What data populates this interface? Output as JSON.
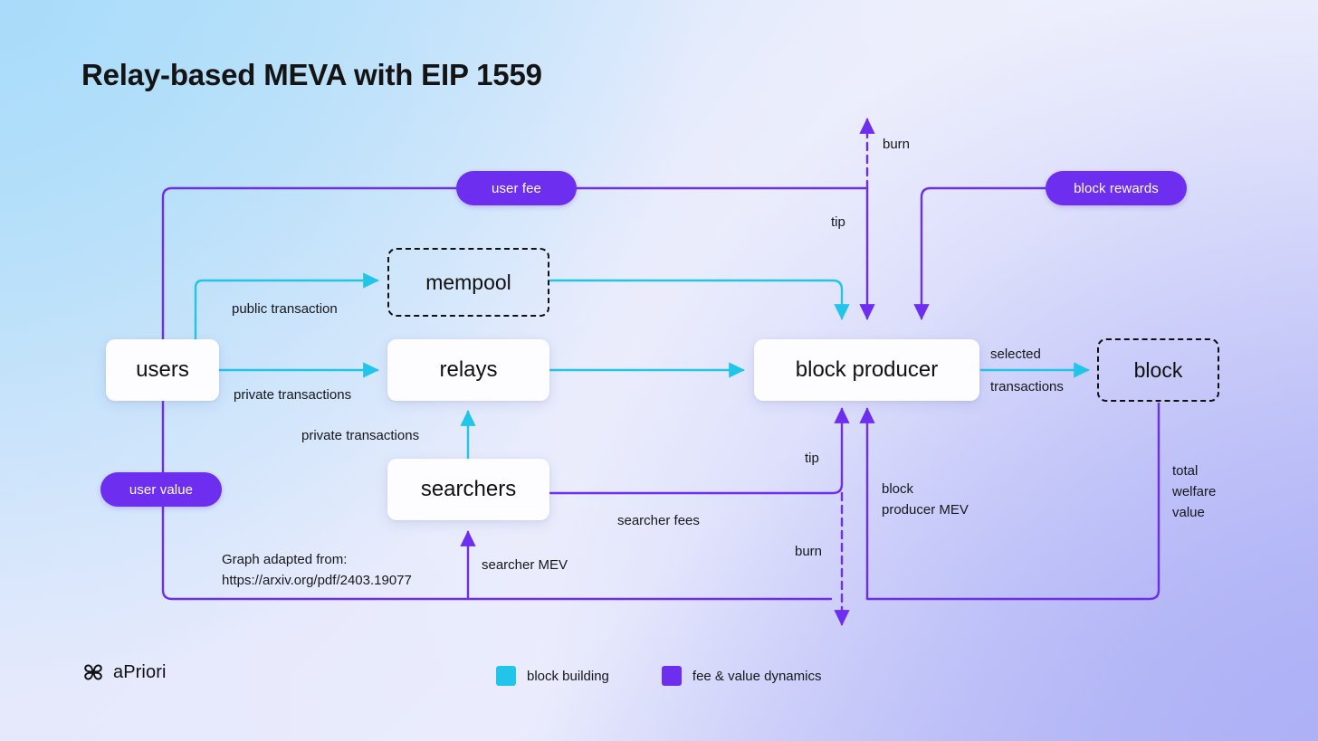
{
  "title": "Relay-based MEVA with EIP 1559",
  "colors": {
    "block_building": "#22c5ea",
    "fee_value": "#6d2ef0",
    "pill_bg": "#6d2ef0",
    "node_text": "#111111",
    "dashed_border": "#111111"
  },
  "nodes": [
    {
      "id": "users",
      "label": "users",
      "style": "solid"
    },
    {
      "id": "mempool",
      "label": "mempool",
      "style": "dashed"
    },
    {
      "id": "relays",
      "label": "relays",
      "style": "solid"
    },
    {
      "id": "searchers",
      "label": "searchers",
      "style": "solid"
    },
    {
      "id": "block-producer",
      "label": "block producer",
      "style": "solid"
    },
    {
      "id": "block",
      "label": "block",
      "style": "dashed"
    }
  ],
  "pills": [
    {
      "id": "user-fee",
      "label": "user fee"
    },
    {
      "id": "block-rewards",
      "label": "block rewards"
    },
    {
      "id": "user-value",
      "label": "user value"
    }
  ],
  "edge_labels": {
    "public_transaction": "public transaction",
    "private_transactions_users": "private transactions",
    "private_transactions_searchers": "private transactions",
    "selected": "selected",
    "transactions": "transactions",
    "burn_top": "burn",
    "tip_top": "tip",
    "tip_bottom": "tip",
    "burn_bottom": "burn",
    "searcher_fees": "searcher fees",
    "searcher_mev": "searcher MEV",
    "block_producer_mev_l1": "block",
    "block_producer_mev_l2": "producer MEV",
    "total_welfare_l1": "total",
    "total_welfare_l2": "welfare",
    "total_welfare_l3": "value"
  },
  "attribution": {
    "line1": "Graph adapted from:",
    "line2": "https://arxiv.org/pdf/2403.19077"
  },
  "brand": {
    "name": "aPriori",
    "icon": "clover-logo-icon"
  },
  "legend": [
    {
      "label": "block building",
      "color": "#22c5ea"
    },
    {
      "label": "fee & value dynamics",
      "color": "#6d2ef0"
    }
  ]
}
